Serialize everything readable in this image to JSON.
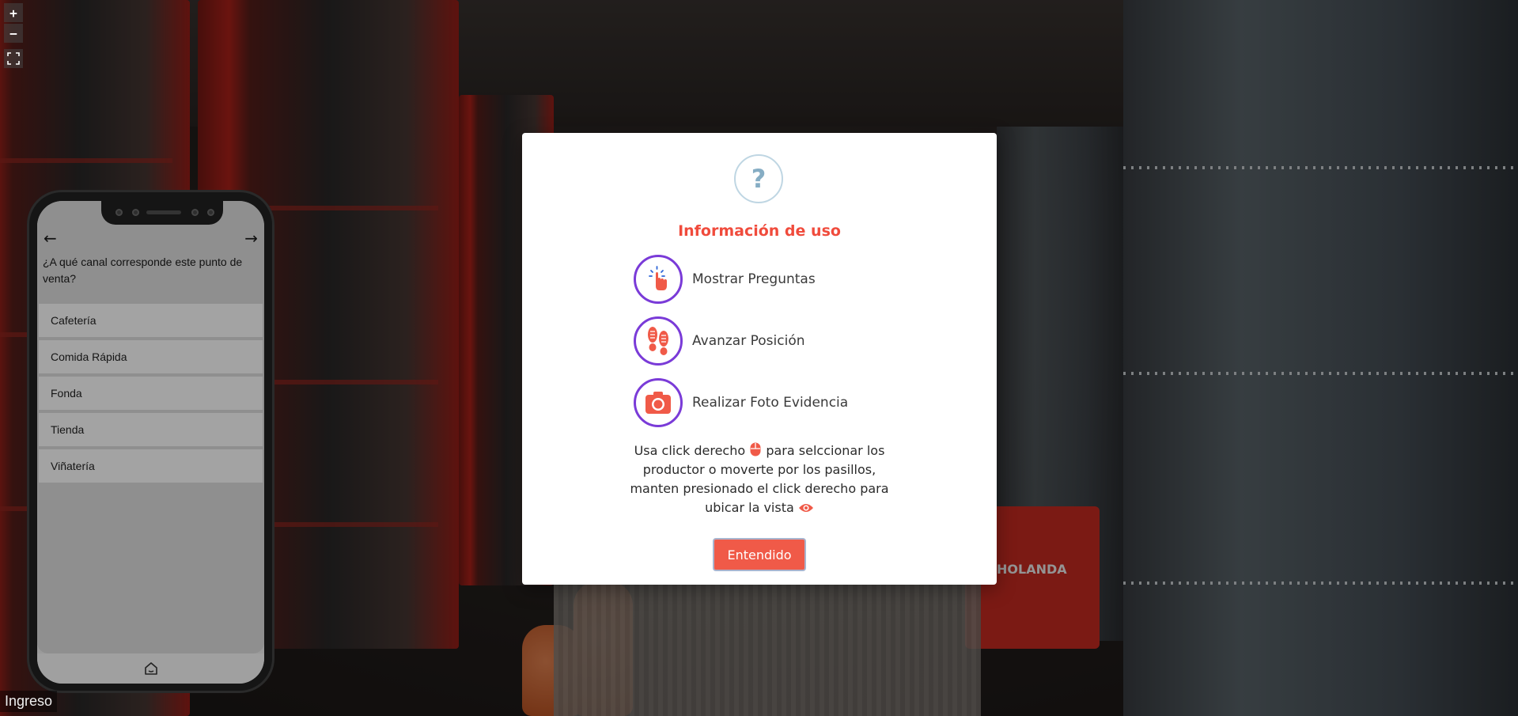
{
  "viewer": {
    "zoom_in_label": "+",
    "zoom_out_label": "−",
    "fullscreen_icon": "fullscreen-icon",
    "scene_label": "Ingreso"
  },
  "phone": {
    "back_arrow": "←",
    "forward_arrow": "→",
    "question": "¿A qué canal corresponde este punto de venta?",
    "options": [
      "Cafetería",
      "Comida Rápida",
      "Fonda",
      "Tienda",
      "Viñatería"
    ],
    "home_icon": "home-icon"
  },
  "modal": {
    "help_icon_text": "?",
    "title": "Información de uso",
    "items": [
      {
        "label": "Mostrar Preguntas",
        "icon": "tap-hand-icon"
      },
      {
        "label": "Avanzar Posición",
        "icon": "footsteps-icon"
      },
      {
        "label": "Realizar Foto Evidencia",
        "icon": "camera-icon"
      }
    ],
    "instructions": {
      "part1": "Usa click derecho",
      "part2": "para selccionar los productor o moverte por los pasillos, manten presionado el click derecho para ubicar la vista"
    },
    "button_label": "Entendido"
  },
  "colors": {
    "accent": "#f04b3c",
    "purple_ring": "#7a3bd8",
    "button": "#f05a48"
  }
}
